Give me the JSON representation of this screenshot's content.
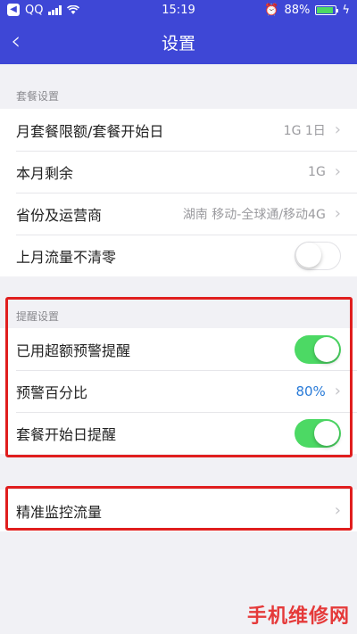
{
  "status": {
    "carrier": "QQ",
    "time": "15:19",
    "battery": "88%"
  },
  "nav": {
    "back_icon": "‹",
    "title": "设置"
  },
  "plan_section": {
    "label": "套餐设置",
    "rows": [
      {
        "label": "月套餐限额/套餐开始日",
        "value": "1G 1日"
      },
      {
        "label": "本月剩余",
        "value": "1G"
      },
      {
        "label": "省份及运营商",
        "value": "湖南 移动-全球通/移动4G"
      },
      {
        "label": "上月流量不清零",
        "toggle": "off"
      }
    ]
  },
  "reminder_section": {
    "label": "提醒设置",
    "rows": [
      {
        "label": "已用超额预警提醒",
        "toggle": "on"
      },
      {
        "label": "预警百分比",
        "value": "80%"
      },
      {
        "label": "套餐开始日提醒",
        "toggle": "on"
      }
    ]
  },
  "monitor": {
    "label": "精准监控流量"
  },
  "chevron": "›",
  "watermark": "手机维修网",
  "colors": {
    "accent": "#3e47d6",
    "toggle_on": "#4cd964",
    "highlight": "#e01e1e",
    "value_blue": "#2a7bd8"
  }
}
